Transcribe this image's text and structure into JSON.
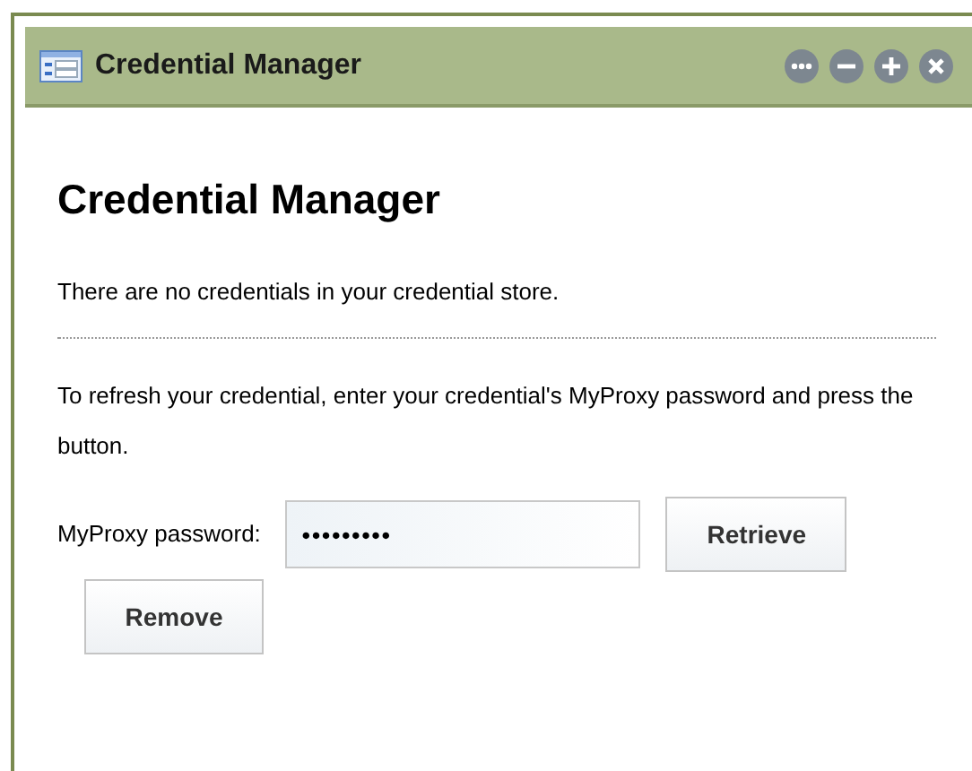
{
  "window": {
    "title": "Credential Manager",
    "controls": [
      {
        "kind": "more"
      },
      {
        "kind": "minimize"
      },
      {
        "kind": "maximize"
      },
      {
        "kind": "close"
      }
    ]
  },
  "heading": "Credential Manager",
  "status_message": "There are no credentials in your credential store.",
  "instructions": "To refresh your credential, enter your credential's MyProxy password and press the button.",
  "password_field": {
    "label": "MyProxy password:",
    "value": "•••••••••"
  },
  "buttons": [
    "Retrieve",
    "Remove"
  ]
}
